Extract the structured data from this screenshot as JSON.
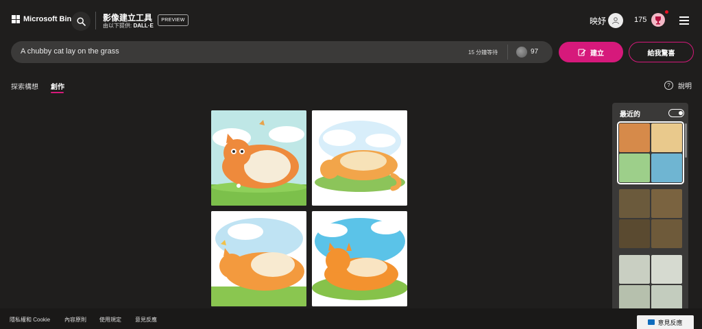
{
  "header": {
    "brand": "Microsoft Bing",
    "tool_title": "影像建立工具",
    "provider_prefix": "由以下提供:",
    "provider_name": "DALL·E",
    "preview_badge": "PREVIEW",
    "username": "映妤",
    "points": "175"
  },
  "prompt": {
    "value": "A chubby cat lay on the grass",
    "wait_text": "15 分鐘等待",
    "boosts": "97",
    "create_label": "建立",
    "surprise_label": "給我驚喜"
  },
  "tabs": {
    "explore": "探索構想",
    "create": "創作",
    "help": "說明"
  },
  "recent": {
    "title": "最近的"
  },
  "footer": {
    "links": [
      "隱私權和 Cookie",
      "內容原則",
      "使用規定",
      "意見反應"
    ],
    "feedback_button": "意見反應"
  },
  "colors": {
    "accent": "#d6197b",
    "background": "#1f1e1d"
  }
}
